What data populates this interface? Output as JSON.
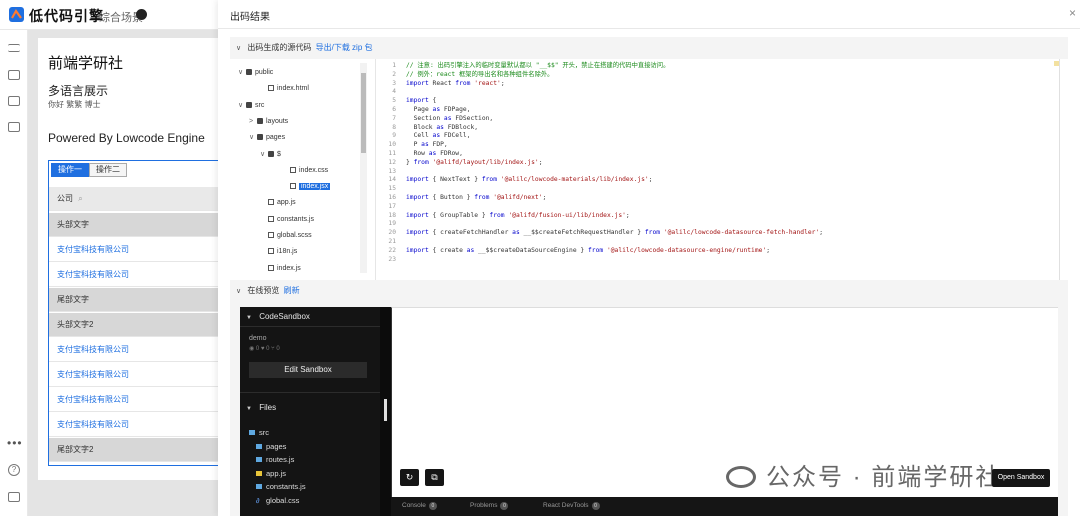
{
  "app": {
    "logo_text": "低代码引擎",
    "scene_link": "综合场景"
  },
  "page": {
    "title": "前端学研社",
    "subtitle": "多语言展示",
    "languages": "你好  繁繁 博士",
    "powered_by": "Powered By Lowcode Engine",
    "table": {
      "tabs": [
        "操作一",
        "操作二"
      ],
      "search_column": "公司",
      "rows": [
        {
          "text": "头部文字",
          "kind": "gray"
        },
        {
          "text": "支付宝科技有限公司",
          "kind": "link"
        },
        {
          "text": "支付宝科技有限公司",
          "kind": "link"
        },
        {
          "text": "尾部文字",
          "kind": "gray"
        },
        {
          "text": "头部文字2",
          "kind": "gray"
        },
        {
          "text": "支付宝科技有限公司",
          "kind": "link"
        },
        {
          "text": "支付宝科技有限公司",
          "kind": "link"
        },
        {
          "text": "支付宝科技有限公司",
          "kind": "link"
        },
        {
          "text": "支付宝科技有限公司",
          "kind": "link"
        },
        {
          "text": "尾部文字2",
          "kind": "gray"
        }
      ]
    }
  },
  "modal": {
    "title": "出码结果",
    "close": "×",
    "code_section": {
      "label": "出码生成的源代码",
      "download_link": "导出/下载 zip 包"
    },
    "preview_section": {
      "label": "在线预览",
      "refresh_link": "刷新"
    }
  },
  "file_tree": [
    {
      "label": "public",
      "type": "folder",
      "depth": 0,
      "caret": "∨"
    },
    {
      "label": "index.html",
      "type": "file",
      "depth": 2,
      "caret": ""
    },
    {
      "label": "src",
      "type": "folder",
      "depth": 0,
      "caret": "∨"
    },
    {
      "label": "layouts",
      "type": "folder",
      "depth": 1,
      "caret": ">"
    },
    {
      "label": "pages",
      "type": "folder",
      "depth": 1,
      "caret": "∨"
    },
    {
      "label": "$",
      "type": "folder",
      "depth": 2,
      "caret": "∨"
    },
    {
      "label": "index.css",
      "type": "file",
      "depth": 4,
      "caret": ""
    },
    {
      "label": "index.jsx",
      "type": "file",
      "depth": 4,
      "caret": "",
      "selected": true
    },
    {
      "label": "app.js",
      "type": "file",
      "depth": 2,
      "caret": ""
    },
    {
      "label": "constants.js",
      "type": "file",
      "depth": 2,
      "caret": ""
    },
    {
      "label": "global.scss",
      "type": "file",
      "depth": 2,
      "caret": ""
    },
    {
      "label": "i18n.js",
      "type": "file",
      "depth": 2,
      "caret": ""
    },
    {
      "label": "index.js",
      "type": "file",
      "depth": 2,
      "caret": ""
    }
  ],
  "code_lines": [
    {
      "n": "1",
      "text": "// 注意: 出码引擎注入的临时变量默认都以 \"__$$\" 开头，禁止在搭建的代码中直接访问。",
      "kind": "comment"
    },
    {
      "n": "2",
      "text": "// 例外：react 框架的导出名和各种组件名除外。",
      "kind": "comment"
    },
    {
      "n": "3",
      "text": "import React from 'react';",
      "kind": "code"
    },
    {
      "n": "4",
      "text": "",
      "kind": "code"
    },
    {
      "n": "5",
      "text": "import {",
      "kind": "code"
    },
    {
      "n": "6",
      "text": "  Page as FDPage,",
      "kind": "code"
    },
    {
      "n": "7",
      "text": "  Section as FDSection,",
      "kind": "code"
    },
    {
      "n": "8",
      "text": "  Block as FDBlock,",
      "kind": "code"
    },
    {
      "n": "9",
      "text": "  Cell as FDCell,",
      "kind": "code"
    },
    {
      "n": "10",
      "text": "  P as FDP,",
      "kind": "code"
    },
    {
      "n": "11",
      "text": "  Row as FDRow,",
      "kind": "code"
    },
    {
      "n": "12",
      "text": "} from '@alifd/layout/lib/index.js';",
      "kind": "code"
    },
    {
      "n": "13",
      "text": "",
      "kind": "code"
    },
    {
      "n": "14",
      "text": "import { NextText } from '@alilc/lowcode-materials/lib/index.js';",
      "kind": "code"
    },
    {
      "n": "15",
      "text": "",
      "kind": "code"
    },
    {
      "n": "16",
      "text": "import { Button } from '@alifd/next';",
      "kind": "code"
    },
    {
      "n": "17",
      "text": "",
      "kind": "code"
    },
    {
      "n": "18",
      "text": "import { GroupTable } from '@alifd/fusion-ui/lib/index.js';",
      "kind": "code"
    },
    {
      "n": "19",
      "text": "",
      "kind": "code"
    },
    {
      "n": "20",
      "text": "import { createFetchHandler as __$$createFetchRequestHandler } from '@alilc/lowcode-datasource-fetch-handler';",
      "kind": "code"
    },
    {
      "n": "21",
      "text": "",
      "kind": "code"
    },
    {
      "n": "22",
      "text": "import { create as __$$createDataSourceEngine } from '@alilc/lowcode-datasource-engine/runtime';",
      "kind": "code"
    },
    {
      "n": "23",
      "text": "",
      "kind": "code"
    }
  ],
  "sandbox": {
    "header": "CodeSandbox",
    "project": "demo",
    "stats": "◉ 0    ♥ 0    ⑂ 0",
    "edit_button": "Edit Sandbox",
    "files_header": "Files",
    "files": [
      {
        "label": "src",
        "type": "dir",
        "depth": 0
      },
      {
        "label": "pages",
        "type": "dir",
        "depth": 1
      },
      {
        "label": "routes.js",
        "type": "dir",
        "depth": 1
      },
      {
        "label": "app.js",
        "type": "js",
        "depth": 1
      },
      {
        "label": "constants.js",
        "type": "dir",
        "depth": 1
      },
      {
        "label": "global.css",
        "type": "css",
        "depth": 1
      }
    ],
    "bottom_tabs": [
      {
        "label": "Console",
        "count": "0"
      },
      {
        "label": "Problems",
        "count": "0"
      },
      {
        "label": "React DevTools",
        "count": "0"
      }
    ],
    "refresh_icon": "↻",
    "open_new_icon": "⧉",
    "open_button": "Open Sandbox"
  },
  "watermark": "公众号 · 前端学研社",
  "colors": {
    "accent": "#1f6fe0",
    "sandbox_dark": "#141414"
  }
}
